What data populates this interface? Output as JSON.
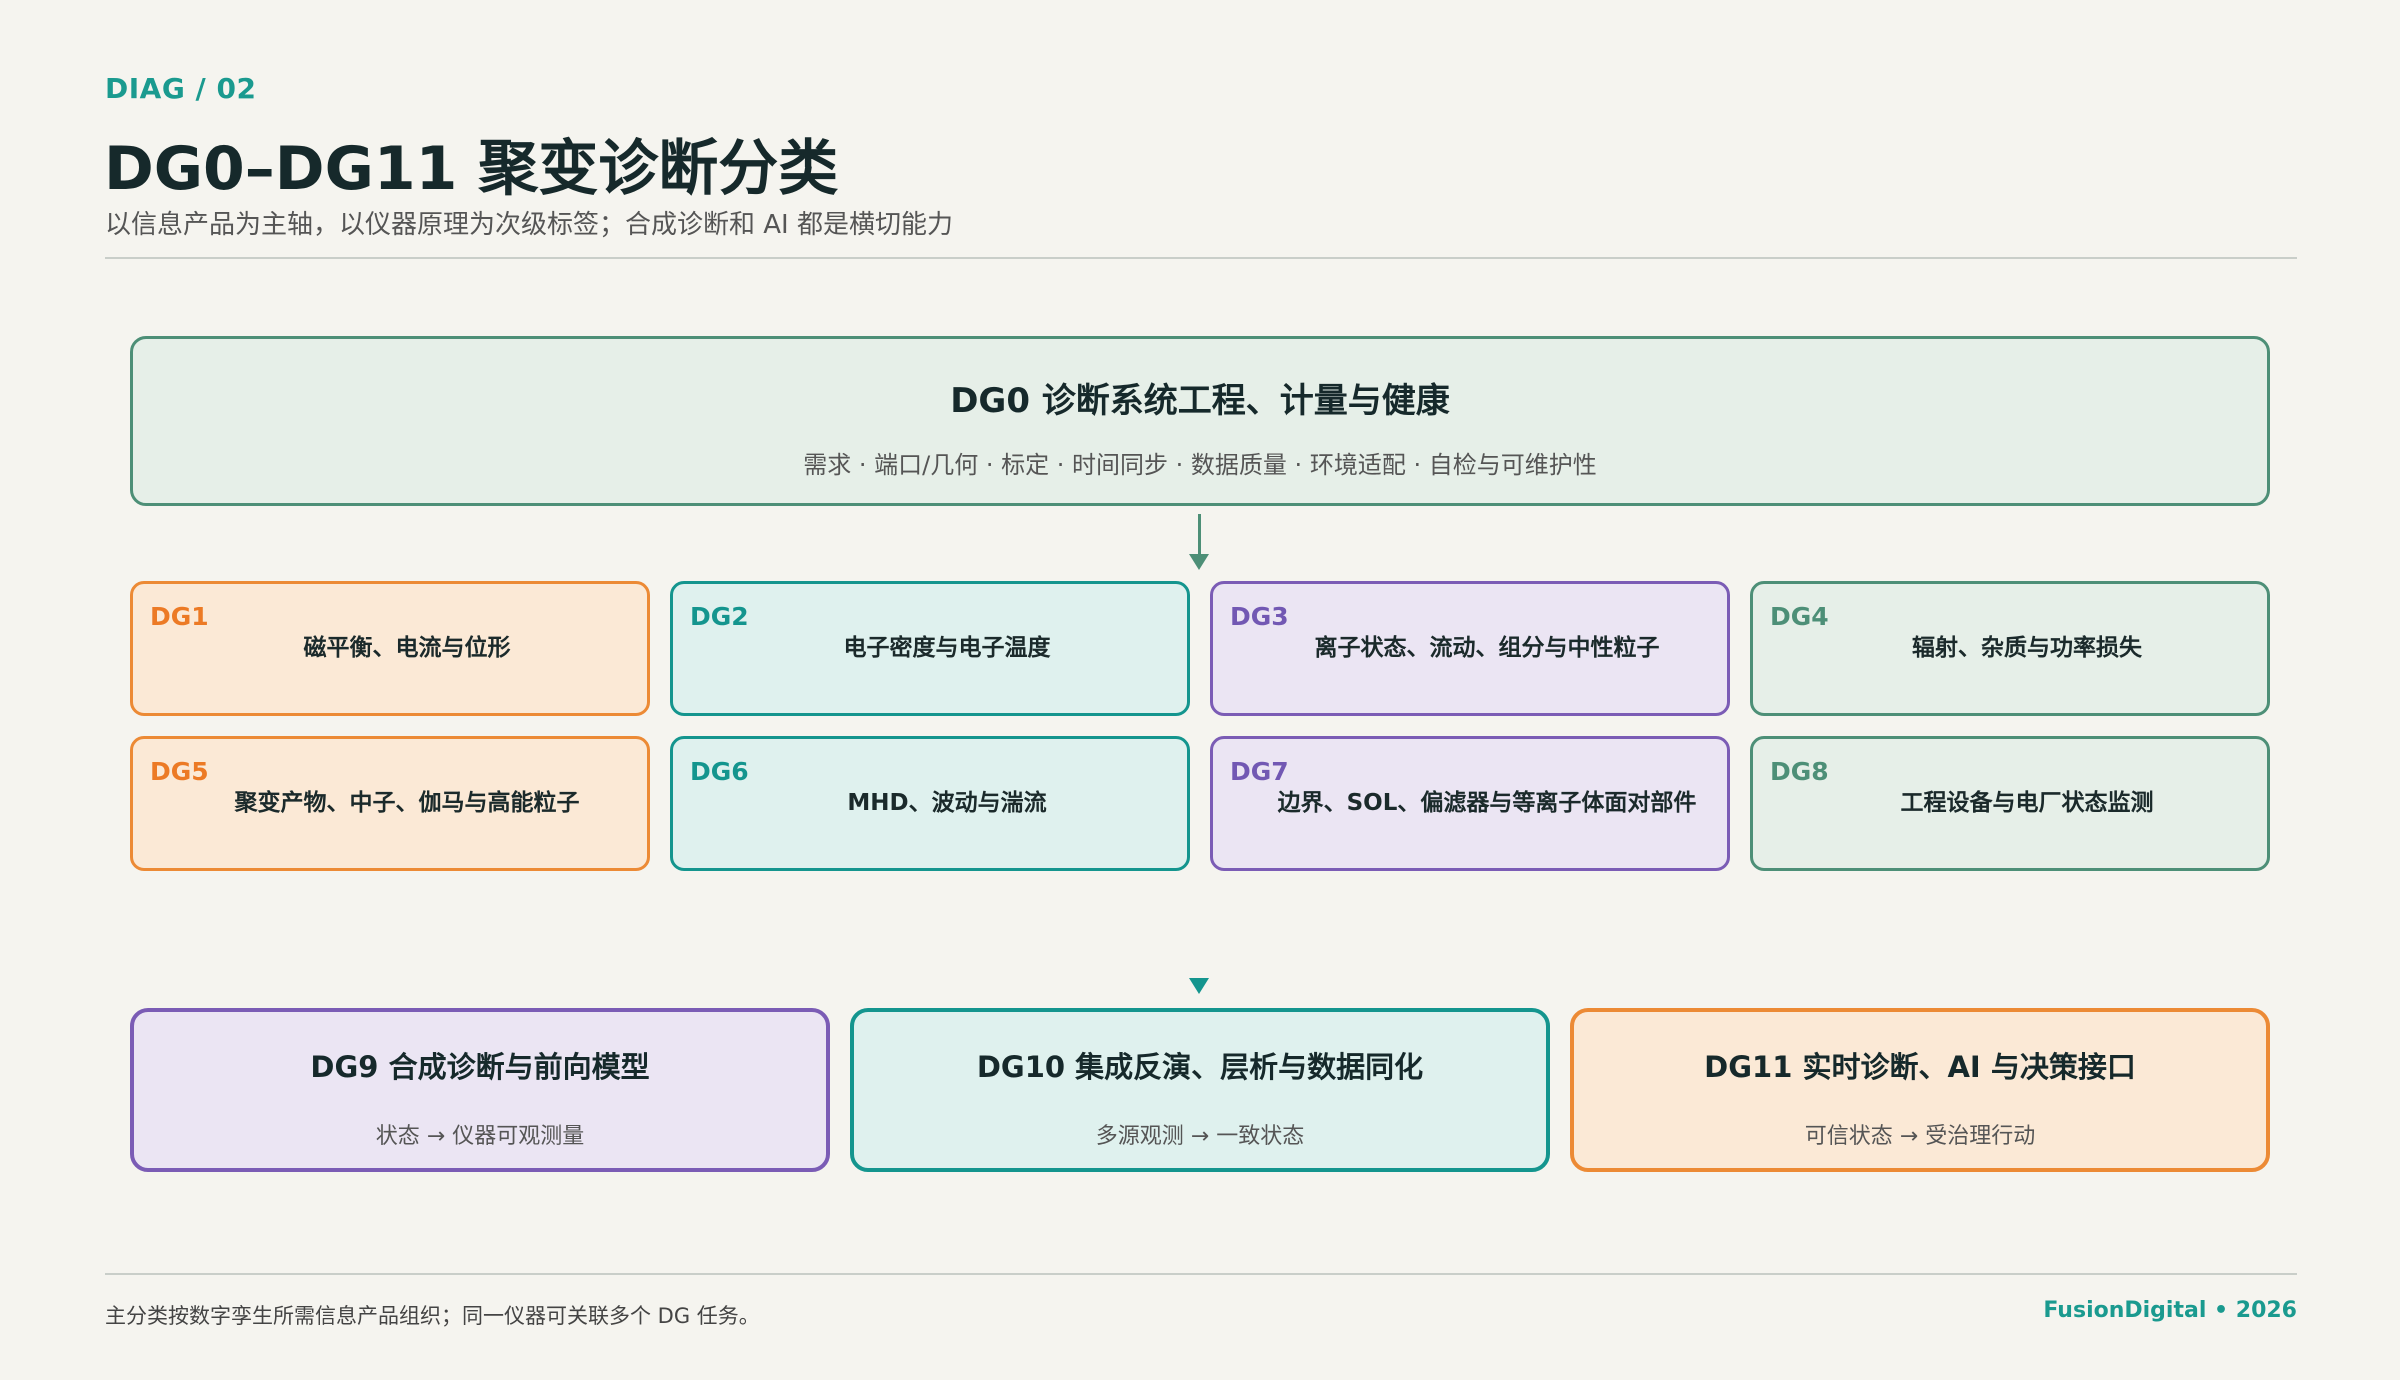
{
  "header": {
    "eyebrow": "DIAG / 02",
    "title": "DG0–DG11 聚变诊断分类",
    "subtitle": "以信息产品为主轴，以仪器原理为次级标签；合成诊断和 AI 都是横切能力"
  },
  "dg0": {
    "title": "DG0  诊断系统工程、计量与健康",
    "subtitle": "需求 · 端口/几何 · 标定 · 时间同步 · 数据质量 · 环境适配 · 自检与可维护性"
  },
  "grid": [
    {
      "code": "DG1",
      "label": "磁平衡、电流与位形"
    },
    {
      "code": "DG2",
      "label": "电子密度与电子温度"
    },
    {
      "code": "DG3",
      "label": "离子状态、流动、组分与中性粒子"
    },
    {
      "code": "DG4",
      "label": "辐射、杂质与功率损失"
    },
    {
      "code": "DG5",
      "label": "聚变产物、中子、伽马与高能粒子"
    },
    {
      "code": "DG6",
      "label": "MHD、波动与湍流"
    },
    {
      "code": "DG7",
      "label": "边界、SOL、偏滤器与等离子体面对部件"
    },
    {
      "code": "DG8",
      "label": "工程设备与电厂状态监测"
    }
  ],
  "bottom": [
    {
      "title": "DG9  合成诊断与前向模型",
      "subtitle": "状态 → 仪器可观测量"
    },
    {
      "title": "DG10  集成反演、层析与数据同化",
      "subtitle": "多源观测 → 一致状态"
    },
    {
      "title": "DG11  实时诊断、AI 与决策接口",
      "subtitle": "可信状态 → 受治理行动"
    }
  ],
  "footer": {
    "note": "主分类按数字孪生所需信息产品组织；同一仪器可关联多个 DG 任务。",
    "brand": "FusionDigital • 2026"
  },
  "colors": {
    "orange": "#ec8a35",
    "teal": "#14958e",
    "purple": "#7b5cb5",
    "green": "#4d8f77",
    "background": "#f5f4ef"
  }
}
